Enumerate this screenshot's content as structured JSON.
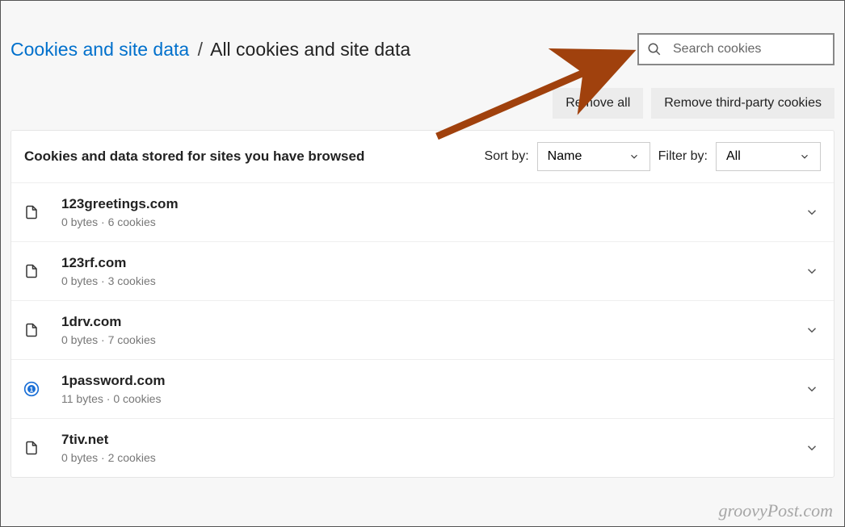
{
  "breadcrumb": {
    "link": "Cookies and site data",
    "separator": "/",
    "current": "All cookies and site data"
  },
  "search": {
    "placeholder": "Search cookies"
  },
  "buttons": {
    "remove_all": "Remove all",
    "remove_third_party": "Remove third-party cookies"
  },
  "card": {
    "title": "Cookies and data stored for sites you have browsed",
    "sort_label": "Sort by:",
    "sort_value": "Name",
    "filter_label": "Filter by:",
    "filter_value": "All"
  },
  "sites": [
    {
      "name": "123greetings.com",
      "meta": "0 bytes · 6 cookies",
      "icon": "doc"
    },
    {
      "name": "123rf.com",
      "meta": "0 bytes · 3 cookies",
      "icon": "doc"
    },
    {
      "name": "1drv.com",
      "meta": "0 bytes · 7 cookies",
      "icon": "doc"
    },
    {
      "name": "1password.com",
      "meta": "11 bytes · 0 cookies",
      "icon": "1p"
    },
    {
      "name": "7tiv.net",
      "meta": "0 bytes · 2 cookies",
      "icon": "doc"
    }
  ],
  "watermark": "groovyPost.com"
}
